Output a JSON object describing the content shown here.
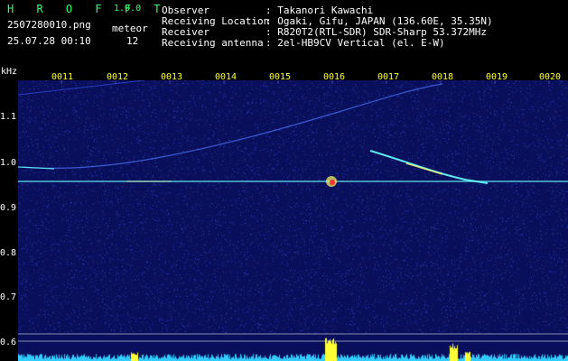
{
  "header": {
    "app_name": "H R O F F T",
    "version": "1.0.0",
    "filename": "2507280010.png",
    "datetime": "25.07.28 00:10",
    "meteor_label": "meteor",
    "meteor_count": "12"
  },
  "info": {
    "observer_label": "Observer",
    "observer_value": ": Takanori Kawachi",
    "location_label": "Receiving Location",
    "location_value": ": Ogaki, Gifu, JAPAN (136.60E, 35.35N)",
    "receiver_label": "Receiver",
    "receiver_value": ": R820T2(RTL-SDR) SDR-Sharp 53.372MHz",
    "antenna_label": "Receiving antenna",
    "antenna_value": ": 2el-HB9CV Vertical (el. E-W)"
  },
  "axis": {
    "y_unit": "kHz",
    "y_ticks": [
      "1.1",
      "1.0",
      "0.9",
      "0.8",
      "0.7",
      "0.6"
    ],
    "time_marks": [
      "0011",
      "0012",
      "0013",
      "0014",
      "0015",
      "0016",
      "0017",
      "0018",
      "0019",
      "0020"
    ]
  },
  "colors": {
    "background": "#000000",
    "spectrogram_bg": "#0a0f5c",
    "signal_cyan": "#66ffff",
    "signal_yellow": "#ffff33",
    "meteor_red": "#ff3333",
    "label_green": "#33ff66"
  }
}
